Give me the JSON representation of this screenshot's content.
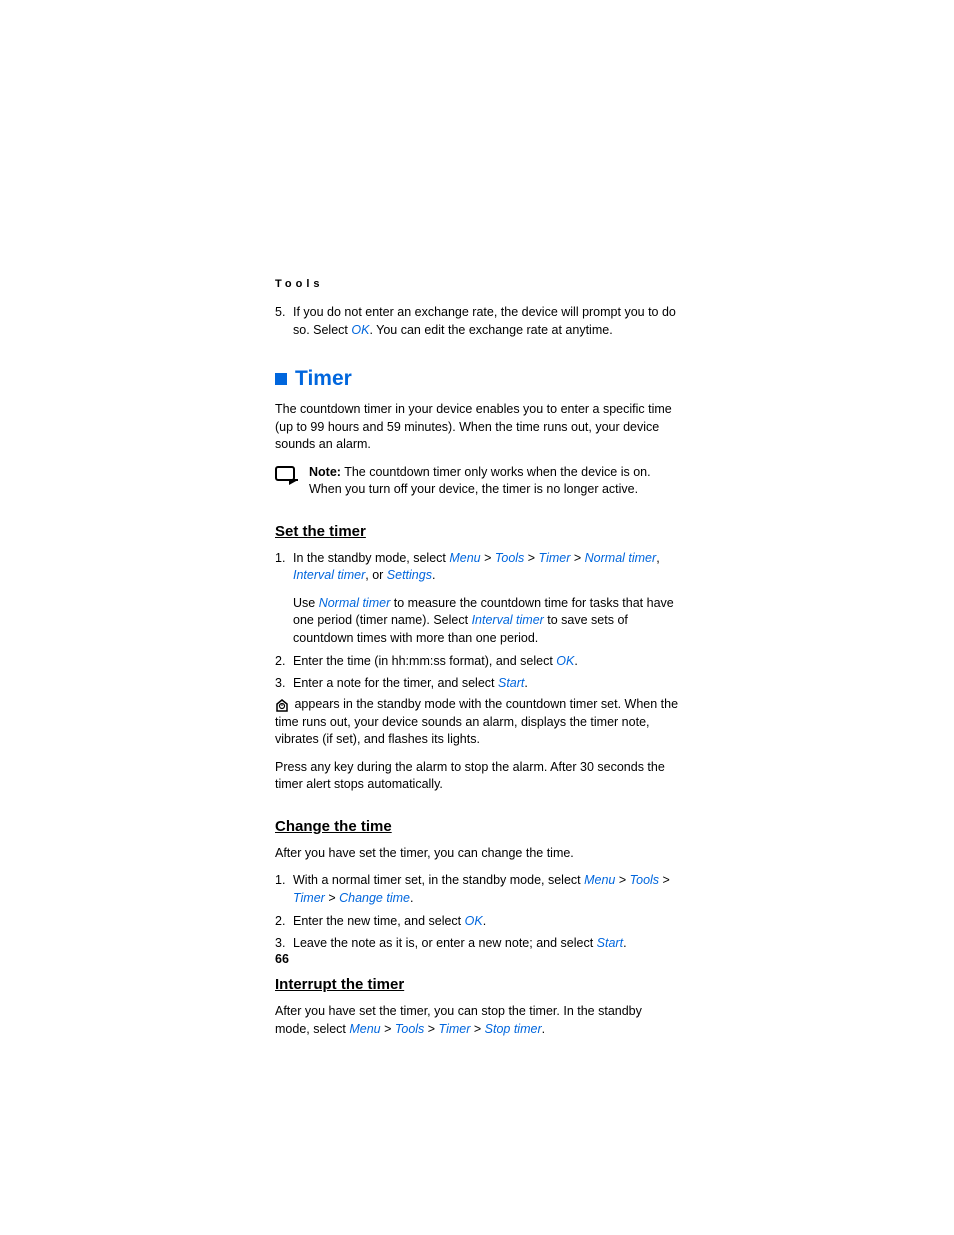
{
  "category": "Tools",
  "step5": {
    "num": "5.",
    "text_a": "If you do not enter an exchange rate, the device will prompt you to do so. Select ",
    "ok": "OK",
    "text_b": ". You can edit the exchange rate at anytime."
  },
  "timer": {
    "heading": "Timer",
    "intro": "The countdown timer in your device enables you to enter a specific time (up to 99 hours and 59 minutes). When the time runs out, your device sounds an alarm.",
    "note_bold": "Note:",
    "note_text": " The countdown timer only works when the device is on. When you turn off your device, the timer is no longer active."
  },
  "set": {
    "heading": "Set the timer",
    "s1": {
      "num": "1.",
      "a": "In the standby mode, select ",
      "menu": "Menu",
      "gt1": " > ",
      "tools": "Tools",
      "gt2": " > ",
      "timer": "Timer",
      "gt3": " > ",
      "normal": "Normal timer",
      "c1": ", ",
      "interval": "Interval timer",
      "c2": ", or ",
      "settings": "Settings",
      "dot": ".",
      "p2a": "Use ",
      "p2normal": "Normal timer",
      "p2b": " to measure the countdown time for tasks that have one period (timer name). Select ",
      "p2interval": "Interval timer",
      "p2c": " to save sets of countdown times with more than one period."
    },
    "s2": {
      "num": "2.",
      "a": "Enter the time (in hh:mm:ss format), and select ",
      "ok": "OK",
      "dot": "."
    },
    "s3": {
      "num": "3.",
      "a": "Enter a note for the timer, and select ",
      "start": "Start",
      "dot": "."
    },
    "para_after": " appears in the standby mode with the countdown timer set. When the time runs out, your device sounds an alarm, displays the timer note, vibrates (if set), and flashes its lights.",
    "para_press": "Press any key during the alarm to stop the alarm. After 30 seconds the timer alert stops automatically."
  },
  "change": {
    "heading": "Change the time",
    "intro": "After you have set the timer, you can change the time.",
    "s1": {
      "num": "1.",
      "a": "With a normal timer set, in the standby mode, select ",
      "menu": "Menu",
      "gt1": " > ",
      "tools": "Tools",
      "gt2": " > ",
      "timer": "Timer",
      "gt3": " > ",
      "changetime": "Change time",
      "dot": "."
    },
    "s2": {
      "num": "2.",
      "a": "Enter the new time, and select ",
      "ok": "OK",
      "dot": "."
    },
    "s3": {
      "num": "3.",
      "a": "Leave the note as it is, or enter a new note; and select ",
      "start": "Start",
      "dot": "."
    }
  },
  "interrupt": {
    "heading": "Interrupt the timer",
    "a": "After you have set the timer, you can stop the timer. In the standby mode, select ",
    "menu": "Menu",
    "gt1": " > ",
    "tools": "Tools",
    "gt2": " > ",
    "timer": "Timer",
    "gt3": " > ",
    "stop": "Stop timer",
    "dot": "."
  },
  "page_number": "66"
}
